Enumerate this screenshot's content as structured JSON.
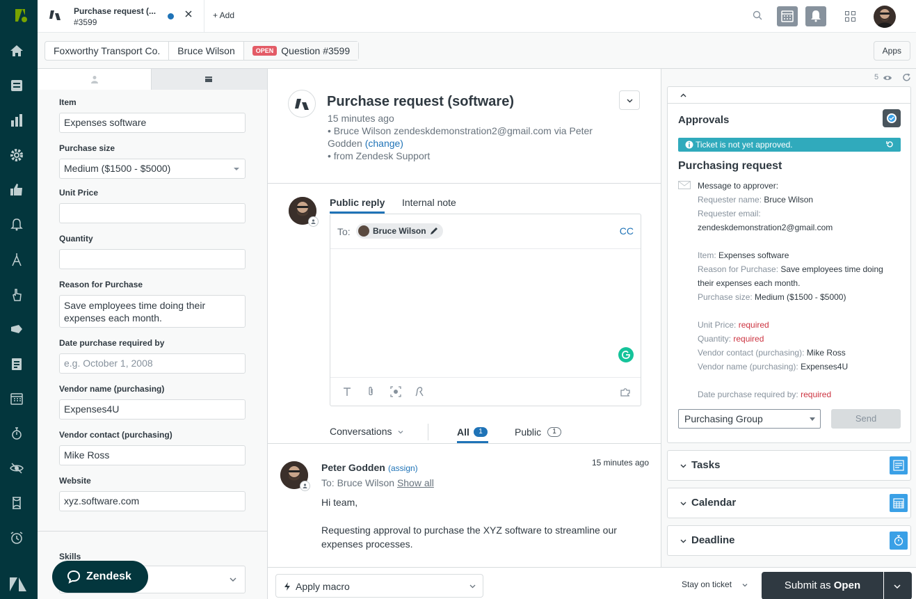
{
  "topbar": {
    "tab_title": "Purchase request (...",
    "tab_subtitle": "#3599",
    "add_label": "+ Add"
  },
  "breadcrumb": {
    "organization": "Foxworthy Transport Co.",
    "requester": "Bruce Wilson",
    "status_badge": "OPEN",
    "ticket": "Question #3599",
    "apps_label": "Apps"
  },
  "ticket_fields": {
    "item": {
      "label": "Item",
      "value": "Expenses software"
    },
    "purchase_size": {
      "label": "Purchase size",
      "value": "Medium ($1500 - $5000)"
    },
    "unit_price": {
      "label": "Unit Price",
      "value": ""
    },
    "quantity": {
      "label": "Quantity",
      "value": ""
    },
    "reason": {
      "label": "Reason for Purchase",
      "value": "Save employees time doing their expenses each month."
    },
    "date_required": {
      "label": "Date purchase required by",
      "placeholder": "e.g. October 1, 2008"
    },
    "vendor_name": {
      "label": "Vendor name (purchasing)",
      "value": "Expenses4U"
    },
    "vendor_contact": {
      "label": "Vendor contact (purchasing)",
      "value": "Mike Ross"
    },
    "website": {
      "label": "Website",
      "value": "xyz.software.com"
    },
    "skills": {
      "label": "Skills"
    }
  },
  "zendesk_button": "Zendesk",
  "ticket": {
    "title": "Purchase request (software)",
    "time": "15 minutes ago",
    "meta_line1": "• Bruce Wilson   zendeskdemonstration2@gmail.com via Peter",
    "meta_line2_prefix": "Godden ",
    "change_link": "(change)",
    "meta_line3": "• from Zendesk Support"
  },
  "composer": {
    "tab_public": "Public reply",
    "tab_internal": "Internal note",
    "to_label": "To:",
    "to_recipient": "Bruce Wilson",
    "cc_label": "CC"
  },
  "conversation_filter": {
    "dropdown_label": "Conversations",
    "all_label": "All",
    "all_count": "1",
    "public_label": "Public",
    "public_count": "1"
  },
  "message": {
    "author": "Peter Godden",
    "assign_link": "(assign)",
    "time": "15 minutes ago",
    "to_prefix": "To: Bruce Wilson ",
    "show_all": "Show all",
    "body_line1": "Hi team,",
    "body_line2": "Requesting approval to purchase the XYZ software to streamline our expenses processes."
  },
  "bottombar": {
    "macro_label": "Apply macro",
    "stay_label": "Stay on ticket",
    "submit_prefix": "Submit as ",
    "submit_status": "Open"
  },
  "apps_panel": {
    "viewer_count": "5",
    "approvals_title": "Approvals",
    "alert_text": "Ticket is not yet approved.",
    "request_title": "Purchasing request",
    "message_header": "Message to approver:",
    "fields": [
      {
        "key": "Requester name:",
        "value": "Bruce Wilson"
      },
      {
        "key": "Requester email:",
        "value": ""
      },
      {
        "key": "",
        "value": "zendeskdemonstration2@gmail.com"
      },
      {
        "key": "Item:",
        "value": "Expenses software"
      },
      {
        "key": "Reason for Purchase:",
        "value": "Save employees time doing their expenses each month."
      },
      {
        "key": "Purchase size:",
        "value": "Medium ($1500 - $5000)"
      },
      {
        "key": "Unit Price:",
        "value": "required"
      },
      {
        "key": "Quantity:",
        "value": "required"
      },
      {
        "key": "Vendor contact (purchasing):",
        "value": "Mike Ross"
      },
      {
        "key": "Vendor name (purchasing):",
        "value": "Expenses4U"
      },
      {
        "key": "Date purchase required by:",
        "value": "required"
      }
    ],
    "group_select": "Purchasing Group",
    "send_label": "Send",
    "collapsed_apps": [
      "Tasks",
      "Calendar",
      "Deadline"
    ]
  },
  "colors": {
    "nav_bg": "#03363d",
    "accent_blue": "#1f73b7",
    "open_badge": "#e35b66",
    "alert_teal": "#30aabc",
    "required_red": "#cc3340",
    "submit_bg": "#2f3941"
  }
}
